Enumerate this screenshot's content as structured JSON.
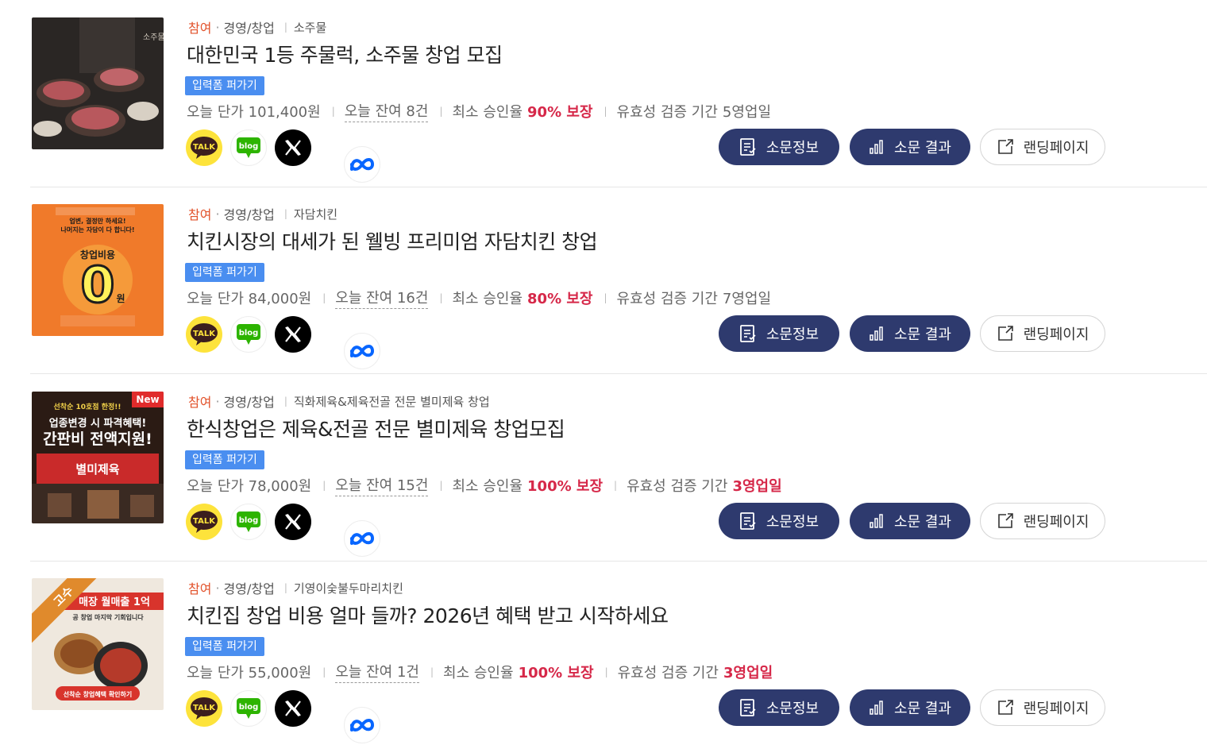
{
  "items": [
    {
      "status": "참여",
      "category": "경영/창업",
      "brand": "소주물",
      "title": "대한민국 1등 주물럭, 소주물 창업 모집",
      "tag": "입력폼 퍼가기",
      "price": "오늘 단가 101,400원",
      "remaining": "오늘 잔여 8건",
      "approval_prefix": "최소 승인율 ",
      "approval": "90% 보장",
      "validity_prefix": "유효성 검증 기간 ",
      "validity": "5영업일",
      "thumb_text": "소주물"
    },
    {
      "status": "참여",
      "category": "경영/창업",
      "brand": "자담치킨",
      "title": "치킨시장의 대세가 된 웰빙 프리미엄 자담치킨 창업",
      "tag": "입력폼 퍼가기",
      "price": "오늘 단가 84,000원",
      "remaining": "오늘 잔여 16건",
      "approval_prefix": "최소 승인율 ",
      "approval": "80% 보장",
      "validity_prefix": "유효성 검증 기간 ",
      "validity": "7영업일",
      "thumb_lines": [
        "업변, 결정만 하세요!",
        "나머지는 자담이 다 합니다!",
        "창업비용",
        "0",
        "원"
      ]
    },
    {
      "status": "참여",
      "category": "경영/창업",
      "brand": "직화제육&제육전골 전문 별미제육 창업",
      "title": "한식창업은 제육&전골 전문 별미제육 창업모집",
      "tag": "입력폼 퍼가기",
      "price": "오늘 단가 78,000원",
      "remaining": "오늘 잔여 15건",
      "approval_prefix": "최소 승인율 ",
      "approval": "100% 보장",
      "validity_prefix": "유효성 검증 기간 ",
      "validity": "3영업일",
      "thumb_badge": "New",
      "thumb_lines": [
        "선착순 10호점 한정!!",
        "업종변경 시 파격혜택!",
        "간판비 전액지원!",
        "별미제육"
      ]
    },
    {
      "status": "참여",
      "category": "경영/창업",
      "brand": "기영이숯불두마리치킨",
      "title": "치킨집 창업 비용 얼마 들까? 2026년 혜택 받고 시작하세요",
      "tag": "입력폼 퍼가기",
      "price": "오늘 단가 55,000원",
      "remaining": "오늘 잔여 1건",
      "approval_prefix": "최소 승인율 ",
      "approval": "100% 보장",
      "validity_prefix": "유효성 검증 기간 ",
      "validity": "3영업일",
      "thumb_ribbon": "고수",
      "thumb_lines": [
        "매장 월매출 1억",
        "공 창업 마지막 기회입니다",
        "선착순 창업혜택 확인하기"
      ]
    }
  ],
  "share": {
    "kakao": "TALK",
    "blog": "blog"
  },
  "buttons": {
    "info": "소문정보",
    "result": "소문 결과",
    "landing": "랜딩페이지"
  },
  "colors": {
    "accent": "#d62849",
    "button": "#2e3a6e",
    "tag": "#4a8ef0",
    "status": "#e2522b"
  }
}
